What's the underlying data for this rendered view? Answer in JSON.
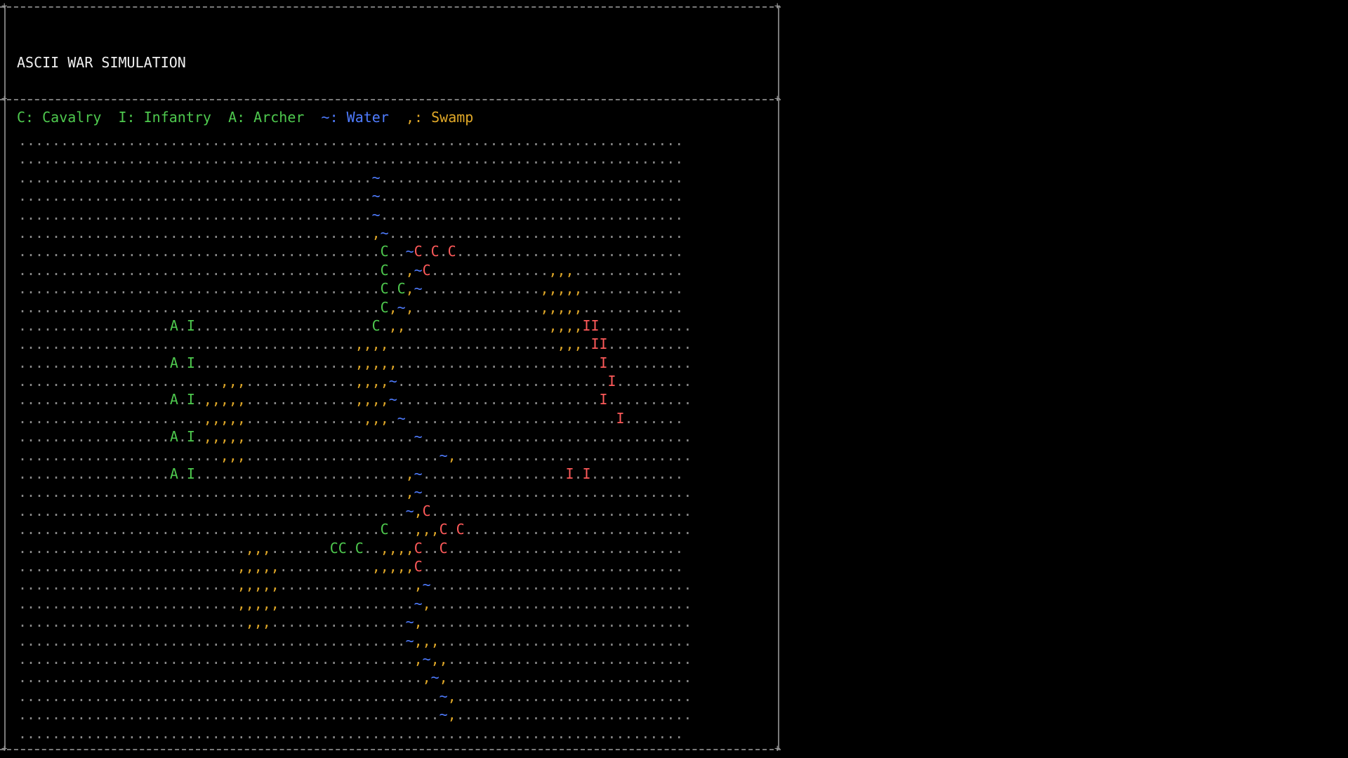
{
  "title": "ASCII WAR SIMULATION",
  "legend": {
    "cavalry": "C: Cavalry",
    "infantry": "I: Infantry",
    "archer": "A: Archer",
    "water_key": "~:",
    "water_label": "Water",
    "swamp_key": ",:",
    "swamp_label": "Swamp"
  },
  "colors": {
    "blue_team": "#4ec94e",
    "red_team": "#ff5a5a",
    "water": "#4f7cff",
    "swamp": "#e0a828",
    "ground": "#8a8a8a",
    "border": "#7a7a7a"
  },
  "map_rows": [
    "...............................................................................",
    "...............................................................................",
    "..........................................~....................................",
    "..........................................~....................................",
    "..........................................~....................................",
    "..........................................,~...................................",
    "...........................................C..~c.c.c...........................",
    "...........................................C..,~c..............,,,.............",
    "...........................................C.C,~..............,,,,,............",
    "...........................................C,~,...............,,,,,............",
    "..................A.I.....................C.,,.................,,,,ii...........",
    "........................................,,,,....................,,,.ii..........",
    "..................A.I...................,,,,,........................i..........",
    "........................,,,.............,,,,~.........................i.........",
    "..................A.I.,,,,,.............,,,,~........................i..........",
    "......................,,,,,..............,,,.~.........................i.......",
    "..................A.I.,,,,,....................~................................",
    "........................,,,.......................~,............................",
    "..................A.I.........................,~.................i.i...........",
    "..............................................,~................................",
    "..............................................~,c...............................",
    "...........................................C...,,,c.c...........................",
    "...........................,,,.......CC.C..,,,,c..c............................",
    "..........................,,,,,...........,,,,,c...............................",
    "..........................,,,,,................,~...............................",
    "..........................,,,,,................~,...............................",
    "...........................,,,................~,................................",
    "..............................................~,,,..............................",
    "...............................................,~,,.............................",
    "................................................,~,.............................",
    "..................................................~,............................",
    "..................................................~,............................",
    "..............................................................................."
  ]
}
